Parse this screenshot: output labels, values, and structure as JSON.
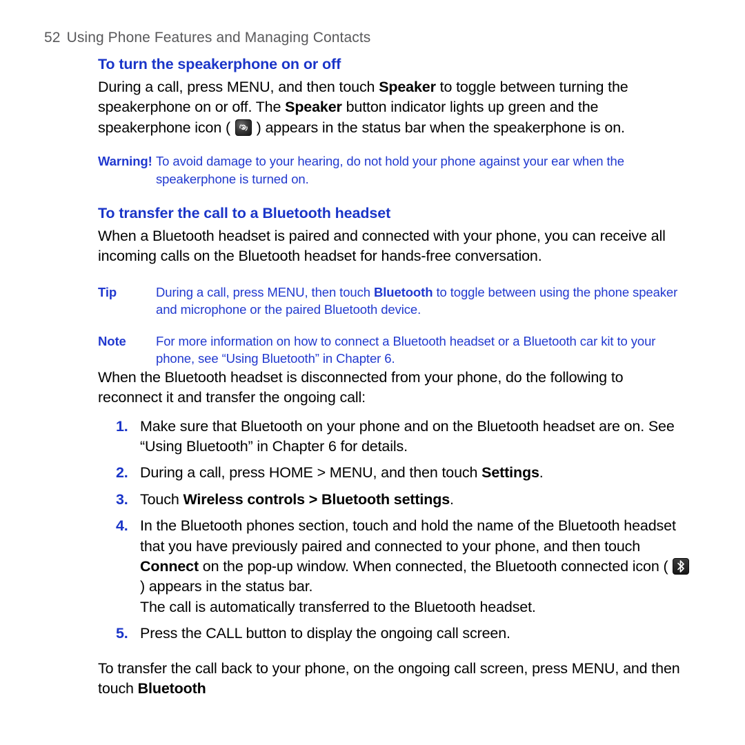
{
  "header": {
    "page_number": "52",
    "title": "Using Phone Features and Managing Contacts",
    "color": "#59595b"
  },
  "theme": {
    "heading_blue": "#1a35c8",
    "callout_blue": "#2139cf",
    "body_black": "#000000"
  },
  "sections": [
    {
      "heading": "To turn the speakerphone on or off",
      "paragraph_part1": "During a call, press MENU, and then touch ",
      "paragraph_bold1": "Speaker",
      "paragraph_part2": " to toggle between turning the speakerphone on or off. The ",
      "paragraph_bold2": "Speaker",
      "paragraph_part3": " button indicator lights up green and the speakerphone icon ( ",
      "paragraph_part4": " ) appears in the status bar when the speakerphone is on."
    },
    {
      "heading": "To transfer the call to a Bluetooth headset",
      "paragraph": "When a Bluetooth headset is paired and connected with your phone, you can receive all incoming calls on the Bluetooth headset for hands-free conversation."
    }
  ],
  "callouts": {
    "warning": {
      "label": "Warning!",
      "text": "To avoid damage to your hearing, do not hold your phone against your ear when the speakerphone is turned on."
    },
    "tip": {
      "label": "Tip",
      "text_part1": "During a call, press MENU, then touch ",
      "text_bold": "Bluetooth",
      "text_part2": " to toggle between using the phone speaker and microphone or the paired Bluetooth device."
    },
    "note": {
      "label": "Note",
      "text": "For more information on how to connect a Bluetooth headset or a Bluetooth car kit to your phone, see “Using Bluetooth” in Chapter 6."
    }
  },
  "intro_paragraph": "When the Bluetooth headset is disconnected from your phone, do the following to reconnect it and transfer the ongoing call:",
  "steps": [
    {
      "num": "1.",
      "text": "Make sure that Bluetooth on your phone and on the Bluetooth headset are on. See “Using Bluetooth” in Chapter 6 for details."
    },
    {
      "num": "2.",
      "part1": "During a call, press HOME > MENU, and then touch ",
      "bold1": "Settings",
      "part2": "."
    },
    {
      "num": "3.",
      "part1": "Touch ",
      "bold1": "Wireless controls > Bluetooth settings",
      "part2": "."
    },
    {
      "num": "4.",
      "part1": "In the Bluetooth phones section, touch and hold the name of the Bluetooth headset that you have previously paired and connected to your phone, and then touch ",
      "bold1": "Connect",
      "part2": " on the pop-up window. When connected, the Bluetooth connected icon ( ",
      "part3": " ) appears in the status bar.",
      "extra_line": "The call is automatically transferred to the Bluetooth headset."
    },
    {
      "num": "5.",
      "text": "Press the CALL button to display the ongoing call screen."
    }
  ],
  "closing": {
    "part1": "To transfer the call back to your phone, on the ongoing call screen, press MENU, and then touch ",
    "bold1": "Bluetooth"
  },
  "icons": {
    "speakerphone": "speakerphone-status-icon",
    "bluetooth": "bluetooth-connected-status-icon"
  }
}
